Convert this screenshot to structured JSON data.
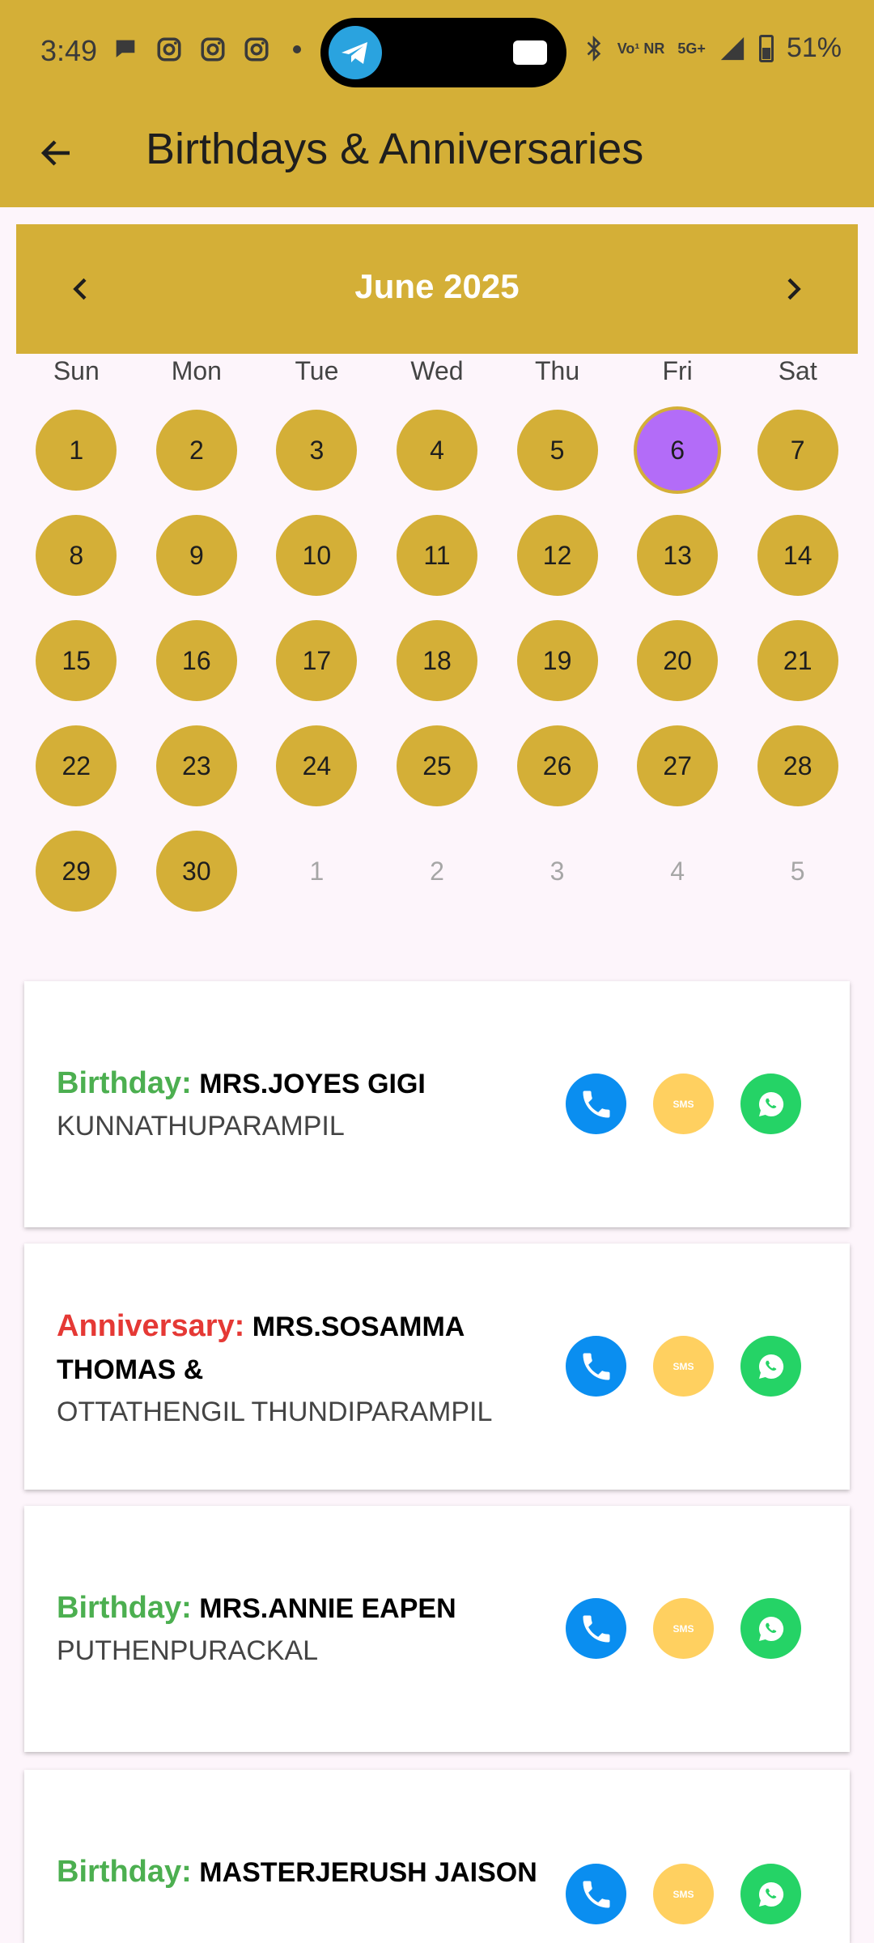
{
  "status_bar": {
    "time": "3:49",
    "network": "5G+",
    "volte": "Vo¹ NR",
    "battery": "51%",
    "left_icons": [
      "chat-bubble-icon",
      "instagram-icon",
      "instagram-icon",
      "instagram-icon"
    ],
    "pill_icons": [
      "telegram-icon",
      "message-icon"
    ]
  },
  "app_bar": {
    "title": "Birthdays & Anniversaries",
    "back_icon": "arrow-left-icon"
  },
  "calendar": {
    "month_label": "June 2025",
    "prev_icon": "chevron-left-icon",
    "next_icon": "chevron-right-icon",
    "weekdays": [
      "Sun",
      "Mon",
      "Tue",
      "Wed",
      "Thu",
      "Fri",
      "Sat"
    ],
    "days": [
      "1",
      "2",
      "3",
      "4",
      "5",
      "6",
      "7",
      "8",
      "9",
      "10",
      "11",
      "12",
      "13",
      "14",
      "15",
      "16",
      "17",
      "18",
      "19",
      "20",
      "21",
      "22",
      "23",
      "24",
      "25",
      "26",
      "27",
      "28",
      "29",
      "30"
    ],
    "trailing_days": [
      "1",
      "2",
      "3",
      "4",
      "5"
    ],
    "selected_day": "6",
    "colors": {
      "day": "#d4af37",
      "selected": "#b36cf8",
      "header": "#d4af37"
    }
  },
  "events": [
    {
      "kind": "Birthday:",
      "type": "birthday",
      "name": "MRS.JOYES GIGI",
      "family": "KUNNATHUPARAMPIL"
    },
    {
      "kind": "Anniversary:",
      "type": "anniversary",
      "name": "MRS.SOSAMMA THOMAS &",
      "family": "OTTATHENGIL THUNDIPARAMPIL"
    },
    {
      "kind": "Birthday:",
      "type": "birthday",
      "name": "MRS.ANNIE EAPEN",
      "family": "PUTHENPURACKAL"
    },
    {
      "kind": "Birthday:",
      "type": "birthday",
      "name": "MASTERJERUSH JAISON",
      "family": ""
    }
  ],
  "actions": {
    "call_icon": "phone-icon",
    "sms_label": "SMS",
    "whatsapp_icon": "whatsapp-icon",
    "colors": {
      "call": "#0a8ef0",
      "sms": "#ffd060",
      "whatsapp": "#25d366"
    }
  }
}
